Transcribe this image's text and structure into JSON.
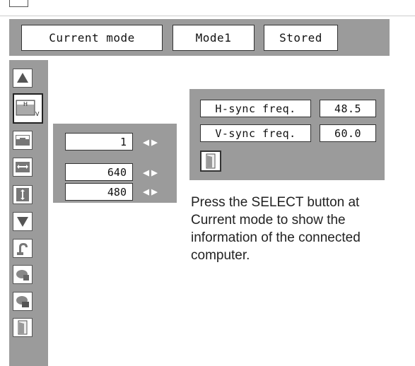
{
  "header": {
    "current_mode_label": "Current mode",
    "mode_label": "Mode1",
    "stored_label": "Stored"
  },
  "sidebar": {
    "icons": [
      "up-arrow-icon",
      "hv-position-icon",
      "h-position-icon",
      "h-width-icon",
      "v-height-icon",
      "down-arrow-icon",
      "reset-icon",
      "store-icon",
      "clear-icon",
      "exit-door-icon"
    ],
    "highlighted_index": 1
  },
  "values": [
    {
      "name": "value-1",
      "value": "1"
    },
    {
      "name": "value-640",
      "value": "640"
    },
    {
      "name": "value-480",
      "value": "480"
    }
  ],
  "info_panel": {
    "hsync_label": "H-sync freq.",
    "hsync_value": "48.5",
    "vsync_label": "V-sync freq.",
    "vsync_value": "60.0",
    "exit_icon": "exit-door-icon"
  },
  "note": {
    "line1": "Press the SELECT button at",
    "line2": "Current mode to show the",
    "line3": "information of the connected",
    "line4": "computer."
  },
  "colors": {
    "panel": "#9b9b9b",
    "box_border": "#333333",
    "arrow": "#ffffff"
  }
}
